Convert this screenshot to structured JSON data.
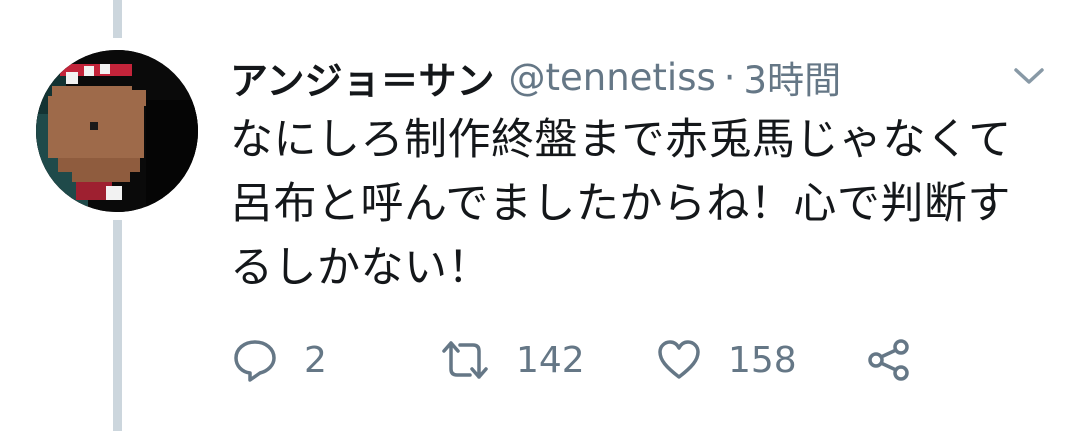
{
  "tweet": {
    "author": {
      "display_name": "アンジョ＝サン",
      "handle": "@tennetiss"
    },
    "separator": "·",
    "time": "3時間",
    "text_lines": [
      "なにしろ制作終盤まで赤兎馬じゃなくて",
      "呂布と呼んでましたからね！心で判断す",
      "るしかない！"
    ],
    "actions": {
      "reply_count": "2",
      "retweet_count": "142",
      "like_count": "158"
    }
  },
  "icons": {
    "reply": "reply-icon",
    "retweet": "retweet-icon",
    "like": "heart-icon",
    "share": "share-icon",
    "menu": "chevron-down-icon"
  },
  "colors": {
    "text": "#14171a",
    "secondary": "#657786",
    "thread_line": "#ccd6dd"
  }
}
